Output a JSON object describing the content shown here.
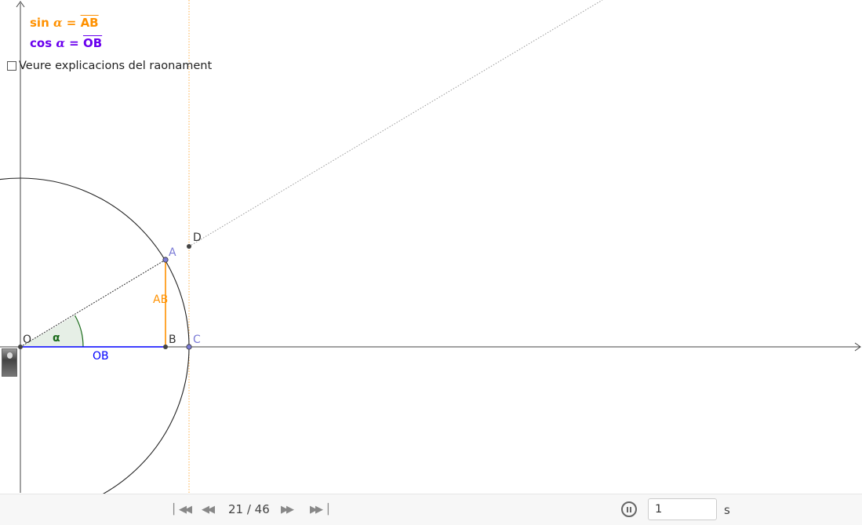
{
  "formulas": {
    "sin": {
      "fn": "sin",
      "var": "α",
      "eq": "=",
      "seg": "AB"
    },
    "cos": {
      "fn": "cos",
      "var": "α",
      "eq": "=",
      "seg": "OB"
    }
  },
  "checkbox": {
    "label": "Veure explicacions del raonament",
    "checked": false
  },
  "labels": {
    "O": "O",
    "A": "A",
    "B": "B",
    "C": "C",
    "D": "D",
    "alpha": "α",
    "AB": "AB",
    "OB": "OB"
  },
  "colors": {
    "sin": "#ff9100",
    "cos": "#6a00ee",
    "OB_segment": "#0000ff",
    "AB_segment": "#ff9100",
    "point_blue": "#7b7bd6",
    "angle_fill": "#e6efe6",
    "angle_stroke": "#1a6b1a"
  },
  "toolbar": {
    "first_icon": "skip-first-icon",
    "prev_icon": "rewind-icon",
    "next_icon": "fast-forward-icon",
    "last_icon": "skip-last-icon",
    "step_counter": "21 / 46",
    "pause_icon": "pause-icon",
    "speed_value": "1",
    "speed_unit": "s"
  }
}
